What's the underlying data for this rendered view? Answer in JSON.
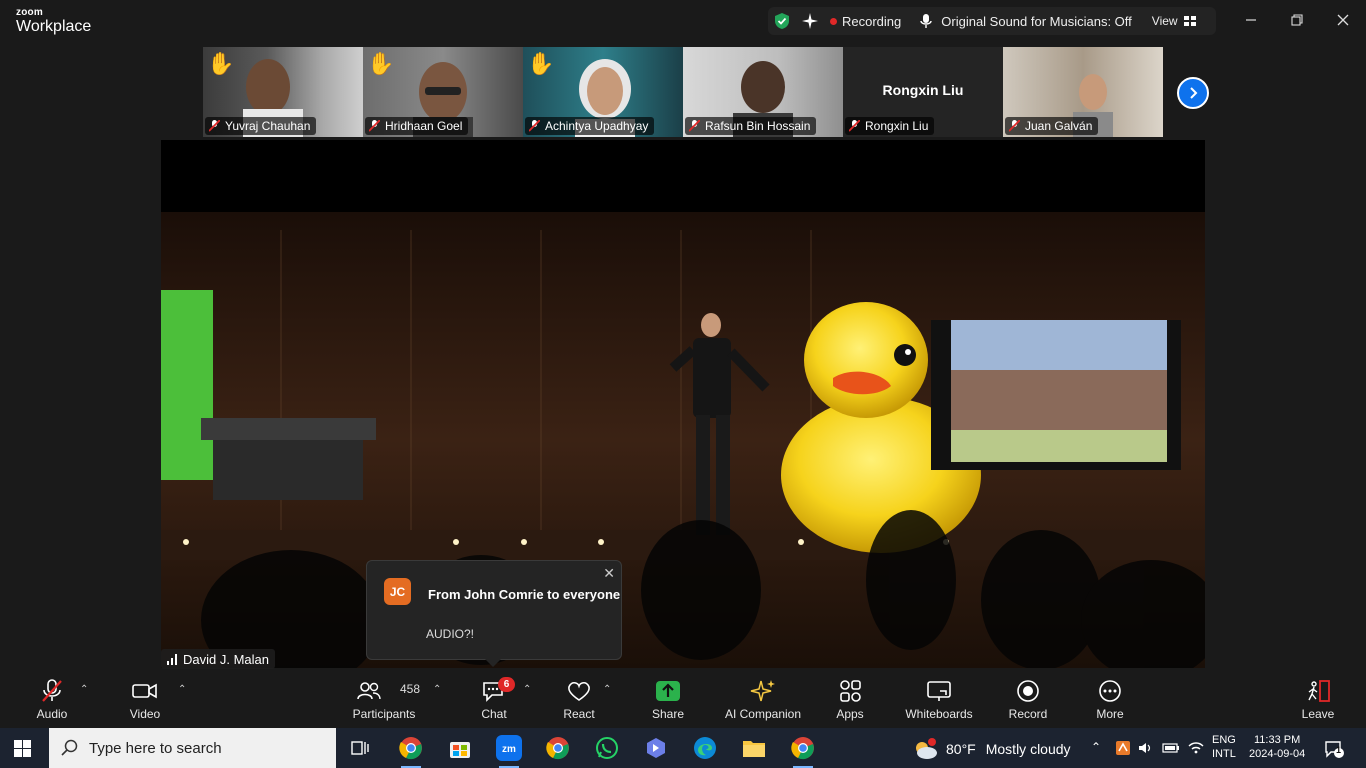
{
  "app": {
    "brand_top": "zoom",
    "brand_bottom": "Workplace"
  },
  "status": {
    "recording": "Recording",
    "original_sound": "Original Sound for Musicians: Off",
    "view": "View"
  },
  "participants_strip": [
    {
      "name": "Yuvraj Chauhan",
      "hand_raised": true,
      "muted": true
    },
    {
      "name": "Hridhaan Goel",
      "hand_raised": true,
      "muted": true
    },
    {
      "name": "Achintya Upadhyay",
      "hand_raised": true,
      "muted": true
    },
    {
      "name": "Rafsun Bin Hossain",
      "hand_raised": false,
      "muted": true
    },
    {
      "name": "Rongxin Liu",
      "hand_raised": false,
      "muted": true,
      "no_video_label": "Rongxin Liu"
    },
    {
      "name": "Juan Galván",
      "hand_raised": false,
      "muted": true
    }
  ],
  "active_speaker": "David J. Malan",
  "chat_popup": {
    "initials": "JC",
    "from": "From John Comrie to everyone",
    "message": "AUDIO?!"
  },
  "toolbar": {
    "audio": "Audio",
    "video": "Video",
    "participants": "Participants",
    "participants_count": "458",
    "chat": "Chat",
    "chat_badge": "6",
    "react": "React",
    "share": "Share",
    "ai_companion": "AI Companion",
    "apps": "Apps",
    "whiteboards": "Whiteboards",
    "record": "Record",
    "more": "More",
    "leave": "Leave"
  },
  "taskbar": {
    "search_placeholder": "Type here to search",
    "weather_temp": "80°F",
    "weather_text": "Mostly cloudy",
    "lang_top": "ENG",
    "lang_bottom": "INTL",
    "time": "11:33 PM",
    "date": "2024-09-04",
    "notif_count": "1"
  },
  "colors": {
    "accent_blue": "#0e72ed",
    "recording_red": "#e02828",
    "share_green": "#2bb24c",
    "jc_orange": "#e46c22"
  }
}
